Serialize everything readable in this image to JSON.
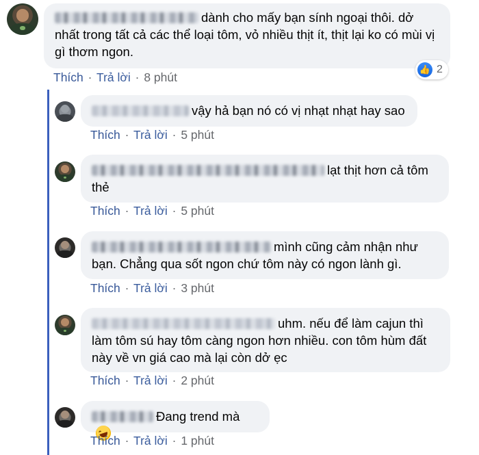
{
  "reply_label": "Trả lời",
  "like_label": "Thích",
  "separator": "·",
  "reaction": {
    "icon": "thumbs-up-icon",
    "count": "2",
    "color": "#1877f2"
  },
  "comments": [
    {
      "text": "dành cho mấy bạn sính ngoại thôi. dở nhất trong tất cả các thể loại tôm, vỏ nhiều thịt ít, thịt lại ko có mùi vị gì thơm ngon.",
      "time": "8 phút"
    },
    {
      "text": "vậy hả bạn nó có vị nhạt nhạt hay sao",
      "time": "5 phút"
    },
    {
      "text": "lạt thịt hơn cả tôm thẻ",
      "time": "5 phút"
    },
    {
      "text": "mình cũng cảm nhận như bạn. Chẳng qua sốt ngon chứ tôm này có ngon lành gì.",
      "time": "3 phút"
    },
    {
      "text": "uhm. nếu để làm cajun thì làm tôm sú hay tôm càng ngon hơn nhiều. con tôm hùm đất này về vn giá cao mà lại còn dở ẹc",
      "time": "2 phút"
    },
    {
      "text": "Đang trend mà",
      "emoji": "rofl-emoji",
      "time": "1 phút"
    }
  ]
}
